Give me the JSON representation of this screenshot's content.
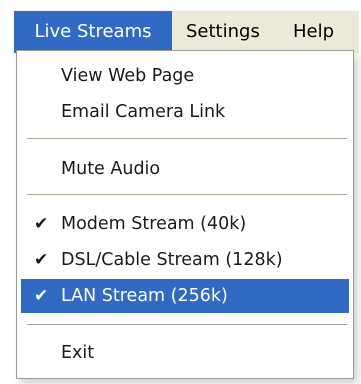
{
  "menubar": {
    "items": [
      {
        "label": "Live Streams",
        "active": true
      },
      {
        "label": "Settings",
        "active": false
      },
      {
        "label": "Help",
        "active": false
      }
    ]
  },
  "dropdown": {
    "items": [
      {
        "label": "View Web Page"
      },
      {
        "label": "Email Camera Link"
      },
      {
        "label": "Mute Audio"
      },
      {
        "label": "Modem Stream (40k)",
        "checked": true
      },
      {
        "label": "DSL/Cable Stream (128k)",
        "checked": true
      },
      {
        "label": "LAN Stream (256k)",
        "checked": true,
        "highlighted": true
      },
      {
        "label": "Exit"
      }
    ],
    "check_glyph": "✔"
  },
  "colors": {
    "highlight": "#316ac5",
    "menubar_background": "#ece9d8",
    "separator": "#aca899"
  }
}
